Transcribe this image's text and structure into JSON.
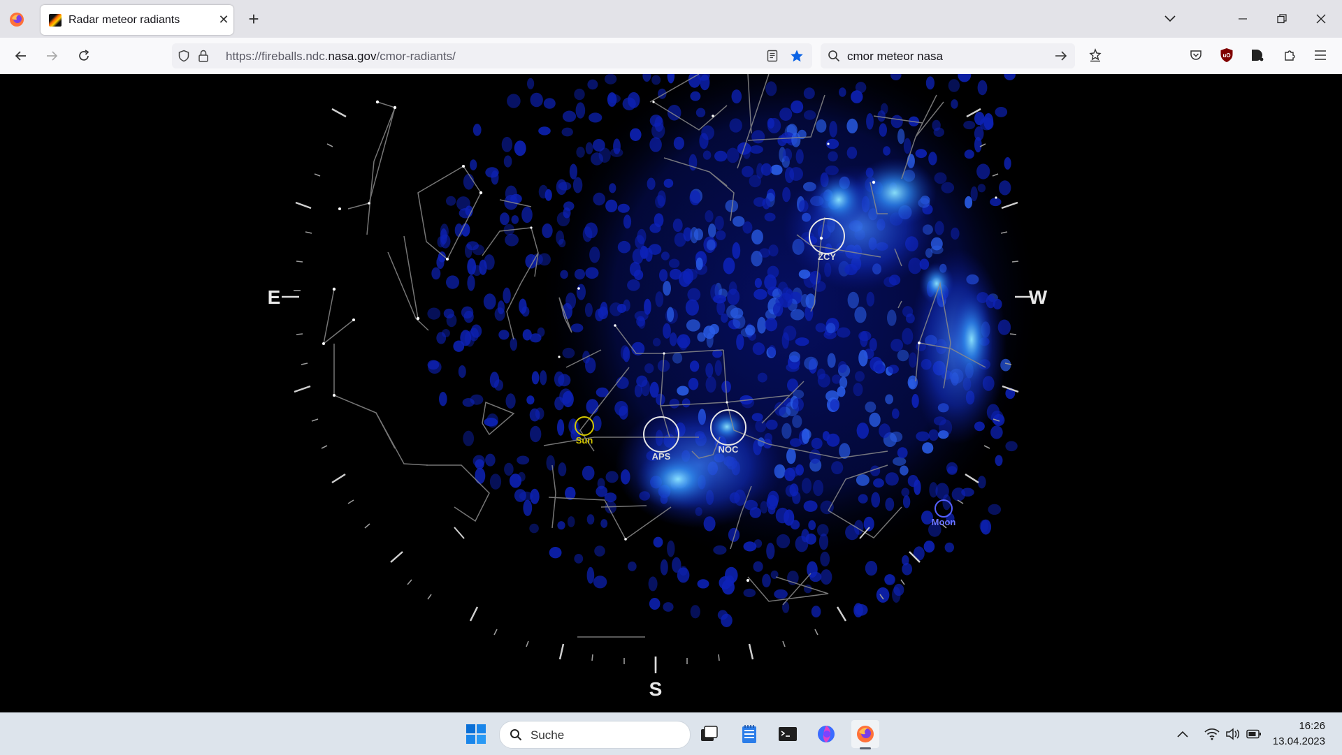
{
  "browser": {
    "tab": {
      "title": "Radar meteor radiants"
    },
    "url": "https://fireballs.ndc.nasa.gov/cmor-radiants/",
    "url_prefix": "https://fireballs.ndc.",
    "url_domain": "nasa.gov",
    "url_path": "/cmor-radiants/",
    "search_query": "cmor meteor nasa"
  },
  "sky": {
    "directions": {
      "east": "E",
      "west": "W",
      "south": "S"
    },
    "sun_label": "Sun",
    "moon_label": "Moon",
    "showers": [
      {
        "code": "ZCY"
      },
      {
        "code": "APS"
      },
      {
        "code": "NOC"
      }
    ],
    "colors": {
      "sun": "#d4c800",
      "moon": "#5560ff",
      "radiant": "#3a8cff",
      "background": "#000000"
    }
  },
  "taskbar": {
    "search_placeholder": "Suche",
    "time": "16:26",
    "date": "13.04.2023"
  }
}
